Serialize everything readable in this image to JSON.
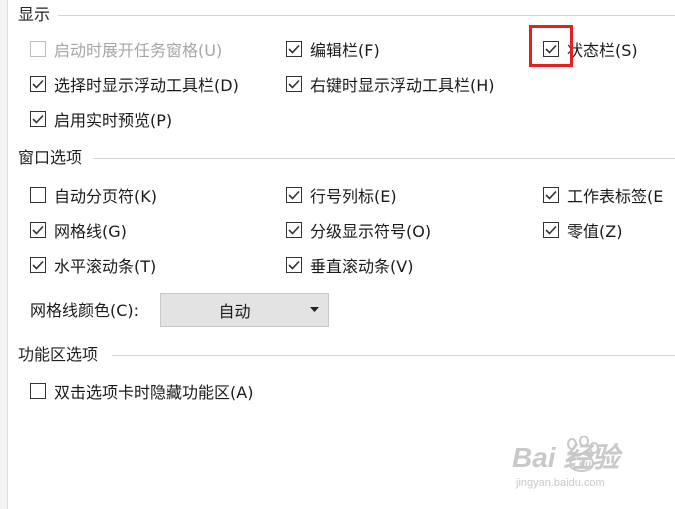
{
  "display": {
    "title": "显示",
    "options": [
      {
        "label": "启动时展开任务窗格(U)",
        "checked": false,
        "disabled": true
      },
      {
        "label": "编辑栏(F)",
        "checked": true,
        "disabled": false
      },
      {
        "label": "状态栏(S)",
        "checked": true,
        "disabled": false
      },
      {
        "label": "选择时显示浮动工具栏(D)",
        "checked": true,
        "disabled": false
      },
      {
        "label": "右键时显示浮动工具栏(H)",
        "checked": true,
        "disabled": false
      },
      {
        "label": "启用实时预览(P)",
        "checked": true,
        "disabled": false
      }
    ]
  },
  "window": {
    "title": "窗口选项",
    "options": [
      {
        "label": "自动分页符(K)",
        "checked": false
      },
      {
        "label": "行号列标(E)",
        "checked": true
      },
      {
        "label": "工作表标签(E",
        "checked": true
      },
      {
        "label": "网格线(G)",
        "checked": true
      },
      {
        "label": "分级显示符号(O)",
        "checked": true
      },
      {
        "label": "零值(Z)",
        "checked": true
      },
      {
        "label": "水平滚动条(T)",
        "checked": true
      },
      {
        "label": "垂直滚动条(V)",
        "checked": true
      }
    ],
    "gridline_color_label": "网格线颜色(C):",
    "gridline_color_value": "自动"
  },
  "ribbon": {
    "title": "功能区选项",
    "options": [
      {
        "label": "双击选项卡时隐藏功能区(A)",
        "checked": false
      }
    ]
  },
  "watermark": {
    "brand": "Bai  经验",
    "url": "jingyan.baidu.com"
  },
  "colors": {
    "highlight": "#e52020",
    "disabled_text": "#a6a6a6",
    "select_bg": "#e3e3e3"
  }
}
